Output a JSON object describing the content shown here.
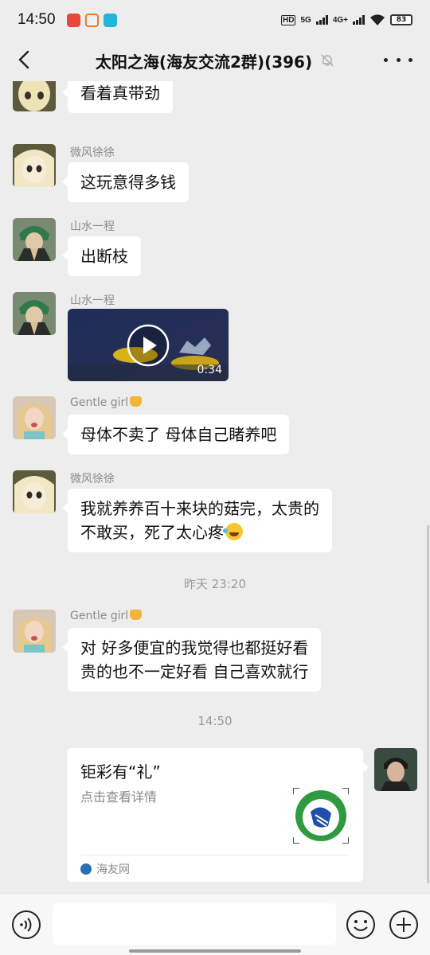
{
  "status_bar": {
    "time": "14:50",
    "hd_label": "HD",
    "net1": "5G",
    "net2": "4G+",
    "battery": "83",
    "app_icons": [
      "red-app-icon",
      "orange-app-icon",
      "cyan-app-icon"
    ]
  },
  "header": {
    "title": "太阳之海(海友交流2群)(396)",
    "icons": [
      "back-arrow-icon",
      "mute-bell-icon",
      "more-dots-icon"
    ]
  },
  "messages": [
    {
      "sender": "",
      "text": "看着真带劲",
      "avatar": "blonde-anime-avatar"
    },
    {
      "sender": "微风徐徐",
      "text": "这玩意得多钱",
      "avatar": "blonde-anime-avatar"
    },
    {
      "sender": "山水一程",
      "text": "出断枝",
      "avatar": "green-hair-anime-avatar"
    },
    {
      "sender": "山水一程",
      "video_duration": "0:34",
      "avatar": "green-hair-anime-avatar"
    },
    {
      "sender": "Gentle girl",
      "text": "母体不卖了 母体自己睹养吧",
      "avatar": "girl-photo-avatar"
    },
    {
      "sender": "微风徐徐",
      "text_line1": "我就养养百十来块的菇完，太贵的",
      "text_line2": "不敢买，死了太心疼",
      "avatar": "blonde-anime-avatar"
    },
    {
      "sender": "Gentle girl",
      "text_line1": "对 好多便宜的我觉得也都挺好看",
      "text_line2": "贵的也不一定好看 自己喜欢就行",
      "avatar": "girl-photo-avatar"
    }
  ],
  "timestamps": [
    "昨天 23:20",
    "14:50"
  ],
  "card": {
    "title": "钜彩有“礼”",
    "description": "点击查看详情",
    "source": "海友网"
  },
  "colors": {
    "background": "#ededed",
    "bubble": "#ffffff",
    "secondary_text": "#8a8a8a"
  }
}
